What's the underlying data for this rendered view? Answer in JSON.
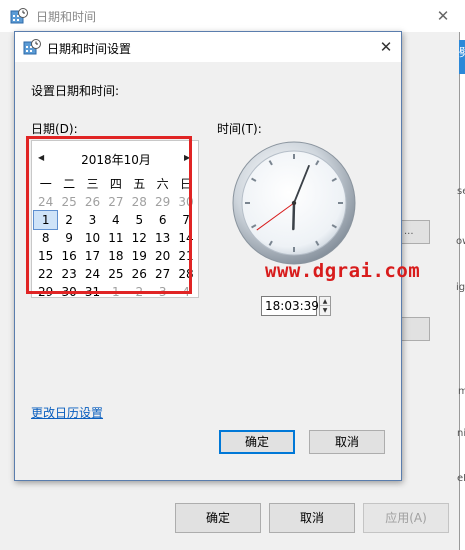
{
  "outer": {
    "title": "日期和时间",
    "close_glyph": "✕",
    "buttons": {
      "ok": "确定",
      "cancel": "取消",
      "apply": "应用(A)"
    },
    "edge_chars": [
      "劈",
      "se",
      "ow",
      "ig",
      "m",
      "eL",
      "ni"
    ]
  },
  "dialog": {
    "title": "日期和时间设置",
    "close_glyph": "✕",
    "heading": "设置日期和时间:",
    "date_label": "日期(D):",
    "time_label": "时间(T):",
    "calendar": {
      "month_label": "2018年10月",
      "prev_glyph": "◀",
      "next_glyph": "▶",
      "weekdays": [
        "一",
        "二",
        "三",
        "四",
        "五",
        "六",
        "日"
      ],
      "weeks": [
        [
          "24",
          "25",
          "26",
          "27",
          "28",
          "29",
          "30"
        ],
        [
          "1",
          "2",
          "3",
          "4",
          "5",
          "6",
          "7"
        ],
        [
          "8",
          "9",
          "10",
          "11",
          "12",
          "13",
          "14"
        ],
        [
          "15",
          "16",
          "17",
          "18",
          "19",
          "20",
          "21"
        ],
        [
          "22",
          "23",
          "24",
          "25",
          "26",
          "27",
          "28"
        ],
        [
          "29",
          "30",
          "31",
          "1",
          "2",
          "3",
          "4"
        ]
      ],
      "selected": "1"
    },
    "time_value": "18:03:39",
    "spin_up": "▲",
    "spin_down": "▼",
    "change_calendar_link": "更改日历设置",
    "buttons": {
      "ok": "确定",
      "cancel": "取消"
    }
  },
  "watermark": "www.dgrai.com",
  "colors": {
    "highlight": "#e02424",
    "link": "#0a5fbf",
    "accent": "#0078d7",
    "second_hand": "#d81c1c"
  }
}
